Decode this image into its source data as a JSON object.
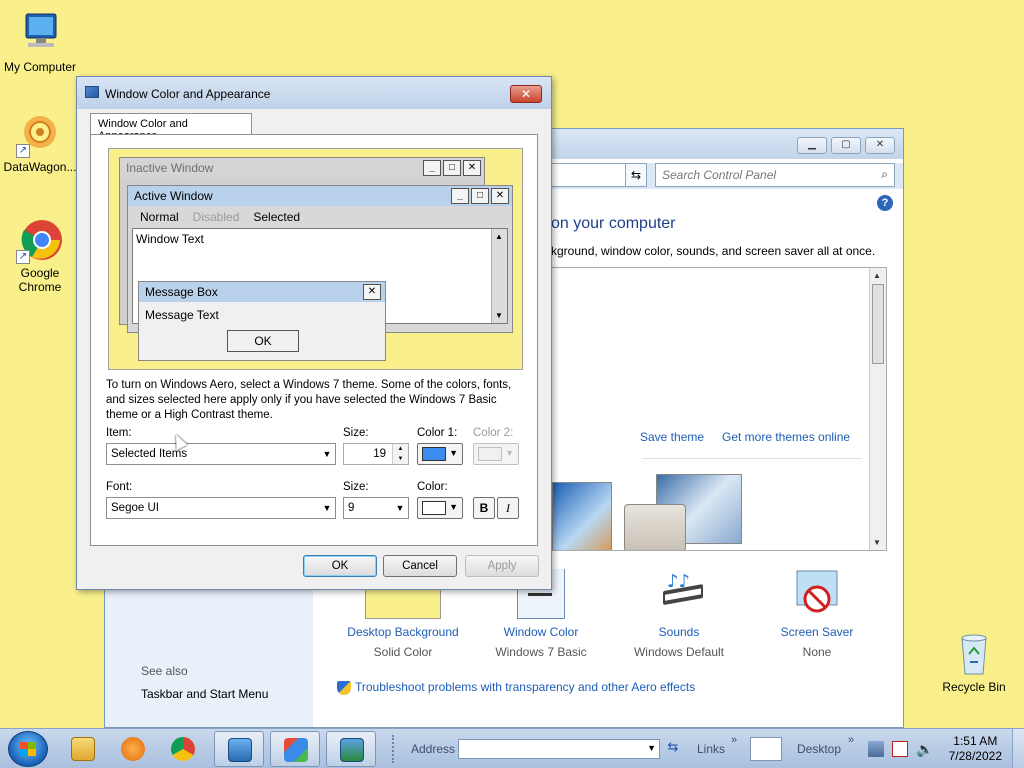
{
  "desktop": {
    "icons": [
      {
        "label": "My Computer",
        "icon": "computer-icon"
      },
      {
        "label": "DataWagon...",
        "icon": "datawagon-icon"
      },
      {
        "label": "Google Chrome",
        "icon": "chrome-icon"
      },
      {
        "label": "Recycle Bin",
        "icon": "recycle-bin-icon"
      }
    ],
    "background_color": "#f9f08c"
  },
  "control_panel": {
    "search_placeholder": "Search Control Panel",
    "heading": "on your computer",
    "subtext": "kground, window color, sounds, and screen saver all at once.",
    "save_theme": "Save theme",
    "get_more_themes": "Get more themes online",
    "bottom_items": [
      {
        "title": "Desktop Background",
        "value": "Solid Color",
        "icon": "desktop-background-icon"
      },
      {
        "title": "Window Color",
        "value": "Windows 7 Basic",
        "icon": "window-color-icon"
      },
      {
        "title": "Sounds",
        "value": "Windows Default",
        "icon": "sounds-icon"
      },
      {
        "title": "Screen Saver",
        "value": "None",
        "icon": "screen-saver-icon"
      }
    ],
    "see_also": "See also",
    "taskbar_link": "Taskbar and Start Menu",
    "troubleshoot_link": "Troubleshoot problems with transparency and other Aero effects"
  },
  "dialog": {
    "title": "Window Color and Appearance",
    "close_label": "✕",
    "tab_label": "Window Color and Appearance",
    "preview": {
      "inactive_title": "Inactive Window",
      "active_title": "Active Window",
      "menu": {
        "normal": "Normal",
        "disabled": "Disabled",
        "selected": "Selected"
      },
      "window_text": "Window Text",
      "msgbox_title": "Message Box",
      "msgbox_text": "Message Text",
      "msgbox_ok": "OK"
    },
    "info": "To turn on Windows Aero, select a Windows 7 theme.  Some of the colors, fonts, and sizes selected here apply only if you have selected the Windows 7 Basic theme or a High Contrast theme.",
    "item_label": "Item:",
    "item_value": "Selected Items",
    "size_label": "Size:",
    "size_value": "19",
    "color1_label": "Color 1:",
    "color1_value": "#3c8cf0",
    "color2_label": "Color 2:",
    "font_label": "Font:",
    "font_value": "Segoe UI",
    "font_size_label": "Size:",
    "font_size_value": "9",
    "font_color_label": "Color:",
    "font_color_value": "#ffffff",
    "bold_label": "B",
    "italic_label": "I",
    "ok_label": "OK",
    "cancel_label": "Cancel",
    "apply_label": "Apply"
  },
  "taskbar": {
    "address_label": "Address",
    "links_label": "Links",
    "desktop_label": "Desktop",
    "time": "1:51 AM",
    "date": "7/28/2022",
    "pinned": [
      "explorer-icon",
      "media-player-icon",
      "chrome-icon",
      "control-panel-icon",
      "display-settings-icon",
      "personalize-icon"
    ]
  }
}
